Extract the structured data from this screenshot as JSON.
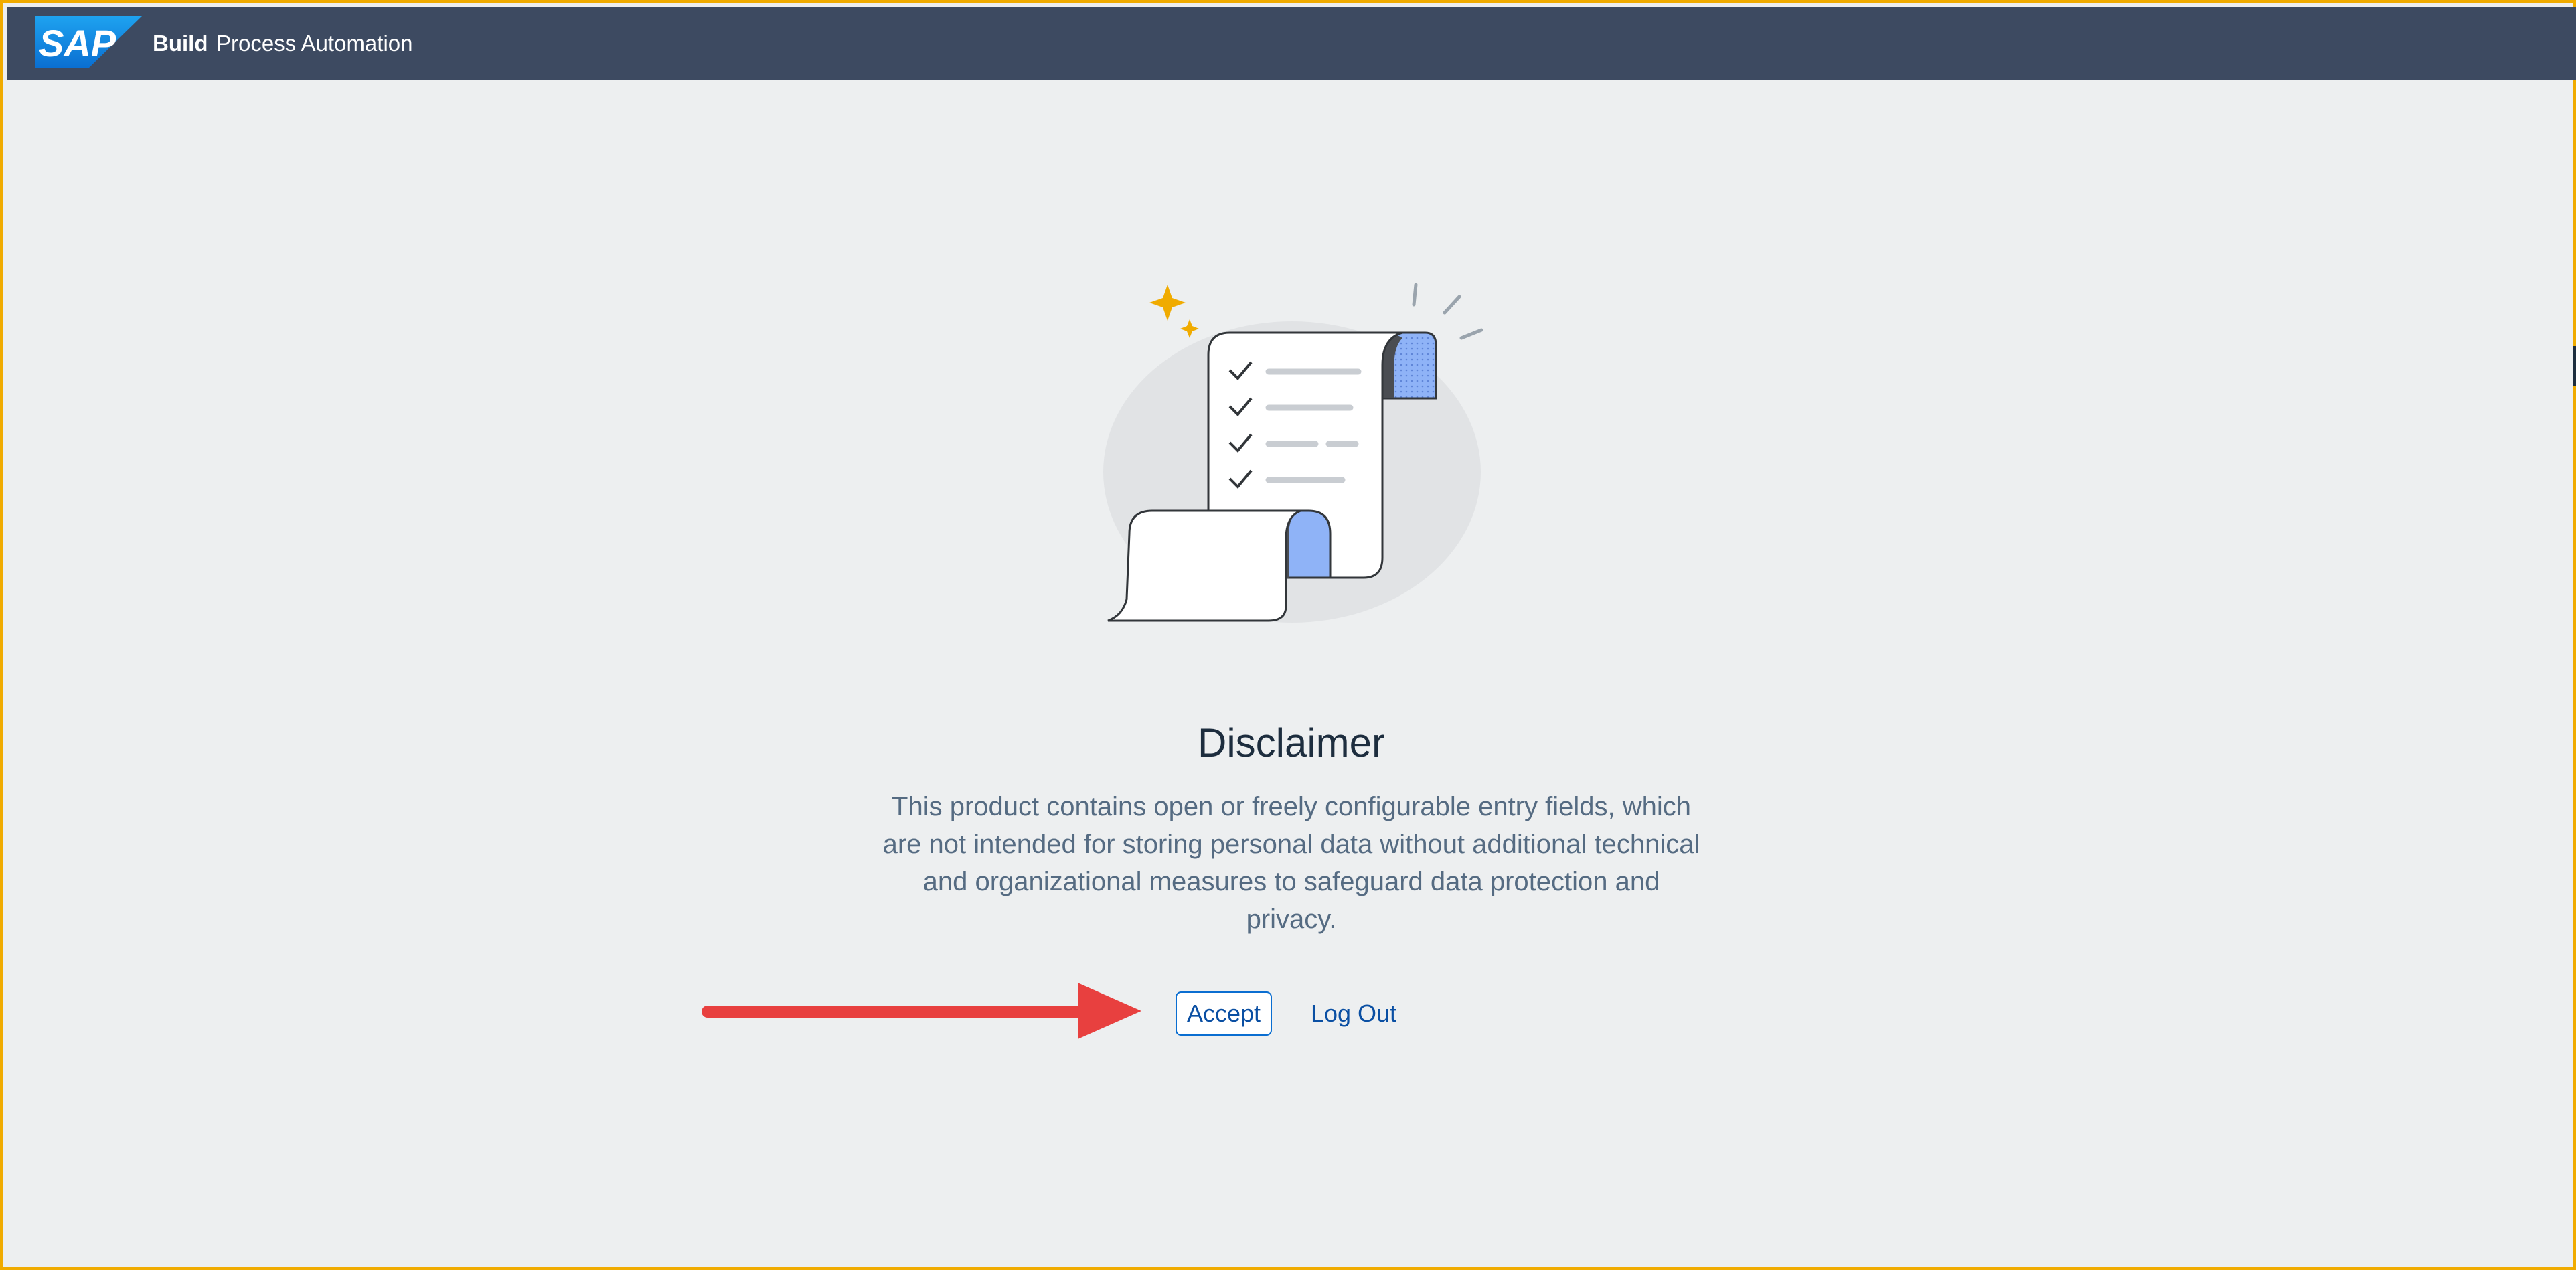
{
  "shell": {
    "brand": "SAP",
    "product_bold": "Build",
    "product_name": "Process Automation"
  },
  "page": {
    "title": "Disclaimer",
    "message": "This product contains open or freely configurable entry fields, which are not intended for storing personal data without additional technical and organizational measures to safeguard data protection and privacy."
  },
  "actions": {
    "accept_label": "Accept",
    "logout_label": "Log Out"
  },
  "colors": {
    "shellbar": "#3d4a61",
    "background": "#edeff0",
    "frame_border": "#f0ab00",
    "link": "#0a4fa3",
    "annotation_arrow": "#e8403f"
  },
  "icons": {
    "logo": "sap-logo",
    "illustration": "scroll-checklist-illustration",
    "annotation": "red-arrow-annotation"
  }
}
